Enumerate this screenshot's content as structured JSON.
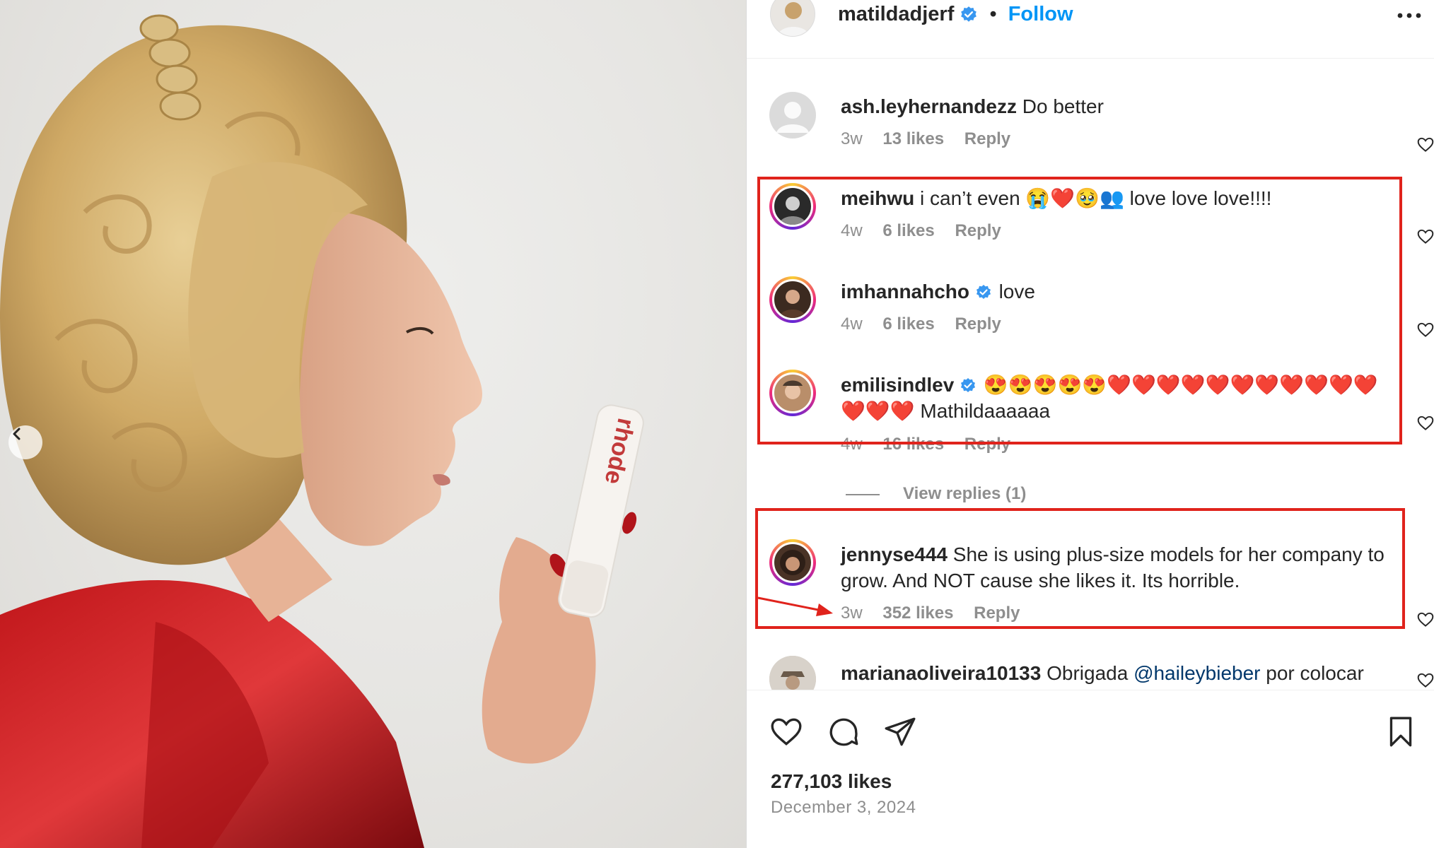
{
  "post": {
    "author": "matildadjerf",
    "separator": "•",
    "follow_label": "Follow",
    "likes": "277,103 likes",
    "date": "December 3, 2024",
    "product_text": "rhode"
  },
  "comments": [
    {
      "user": "ash.leyhernandezz",
      "text": "Do better",
      "age": "3w",
      "likes": "13 likes",
      "reply": "Reply"
    },
    {
      "user": "meihwu",
      "text": "i can’t even 😭❤️🥹👥 love love love!!!!",
      "age": "4w",
      "likes": "6 likes",
      "reply": "Reply"
    },
    {
      "user": "imhannahcho",
      "text": "love",
      "age": "4w",
      "likes": "6 likes",
      "reply": "Reply"
    },
    {
      "user": "emilisindlev",
      "text": "😍😍😍😍😍❤️❤️❤️❤️❤️❤️❤️❤️❤️❤️❤️❤️❤️❤️ Mathildaaaaaa",
      "age": "4w",
      "likes": "16 likes",
      "reply": "Reply"
    },
    {
      "user": "jennyse444",
      "text": "She is using plus-size models for her company to grow. And NOT cause she likes it. Its horrible.",
      "age": "3w",
      "likes": "352 likes",
      "reply": "Reply"
    },
    {
      "user": "marianaoliveira10133",
      "text": "Obrigada",
      "mention": "@haileybieber",
      "text2": "por colocar"
    }
  ],
  "view_replies": "View replies (1)",
  "colors": {
    "annotation_red": "#e0231c",
    "link_blue": "#0095f6",
    "muted_gray": "#8e8e8e",
    "verified_blue": "#3897f0"
  },
  "icons": [
    "chevron-left-icon",
    "verified-icon",
    "more-icon",
    "heart-icon",
    "comment-icon",
    "share-icon",
    "bookmark-icon"
  ]
}
